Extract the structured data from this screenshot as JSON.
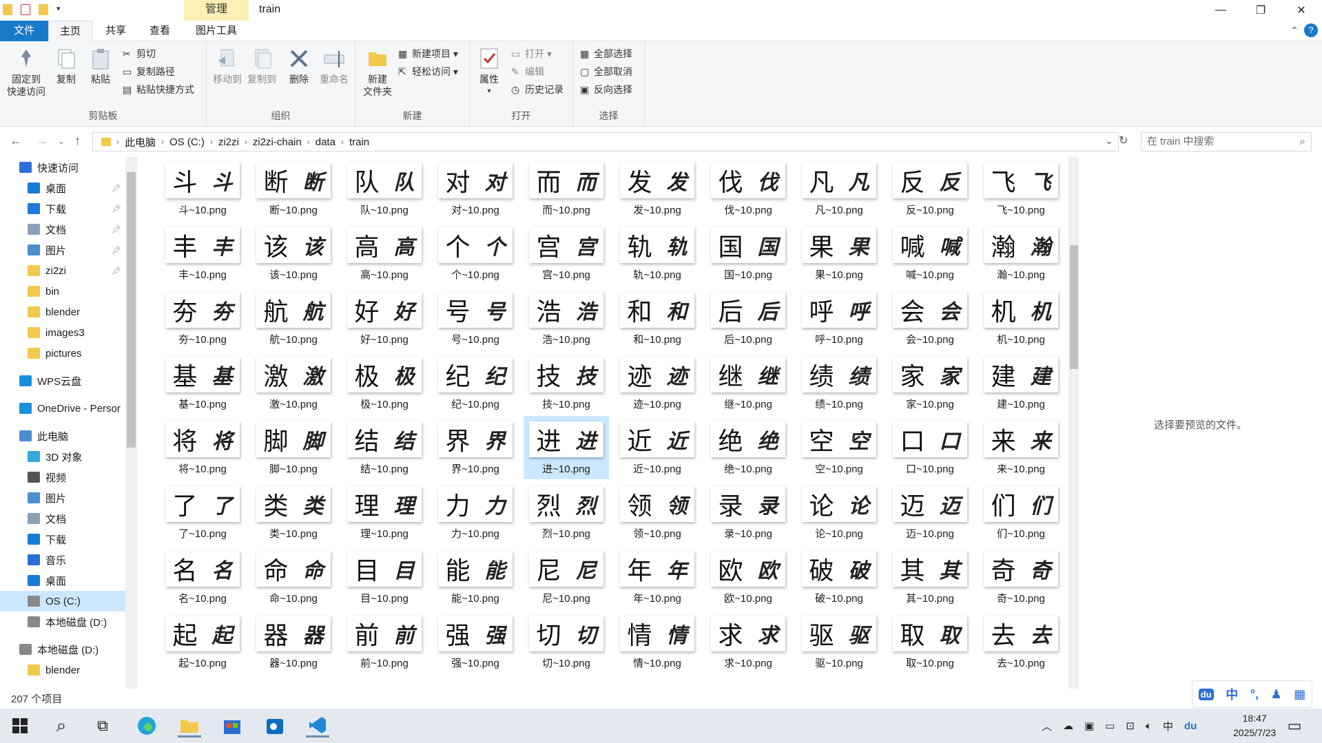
{
  "window": {
    "title": "train",
    "context_tab": "管理",
    "min": "—",
    "max": "❐",
    "close": "✕"
  },
  "tabs": {
    "file": "文件",
    "home": "主页",
    "share": "共享",
    "view": "查看",
    "picture_tools": "图片工具"
  },
  "ribbon": {
    "clipboard": {
      "pin": "固定到\n快速访问",
      "copy": "复制",
      "paste": "粘贴",
      "cut": "剪切",
      "copy_path": "复制路径",
      "paste_shortcut": "粘贴快捷方式",
      "label": "剪贴板"
    },
    "organize": {
      "move_to": "移动到",
      "copy_to": "复制到",
      "delete": "删除",
      "rename": "重命名",
      "label": "组织"
    },
    "new": {
      "new_folder": "新建\n文件夹",
      "new_item": "新建项目 ▾",
      "easy_access": "轻松访问 ▾",
      "label": "新建"
    },
    "open": {
      "properties": "属性",
      "open": "打开 ▾",
      "edit": "编辑",
      "history": "历史记录",
      "label": "打开"
    },
    "select": {
      "select_all": "全部选择",
      "select_none": "全部取消",
      "invert": "反向选择",
      "label": "选择"
    }
  },
  "address": {
    "crumbs": [
      "此电脑",
      "OS (C:)",
      "zi2zi",
      "zi2zi-chain",
      "data",
      "train"
    ],
    "search_placeholder": "在 train 中搜索"
  },
  "nav": {
    "items": [
      {
        "label": "快速访问",
        "level": 0,
        "icon": "star-icon",
        "pinned": false
      },
      {
        "label": "桌面",
        "level": 1,
        "icon": "desktop-icon",
        "pinned": true
      },
      {
        "label": "下载",
        "level": 1,
        "icon": "download-icon",
        "pinned": true
      },
      {
        "label": "文档",
        "level": 1,
        "icon": "document-icon",
        "pinned": true
      },
      {
        "label": "图片",
        "level": 1,
        "icon": "picture-icon",
        "pinned": true
      },
      {
        "label": "zi2zi",
        "level": 1,
        "icon": "folder-icon",
        "pinned": true
      },
      {
        "label": "bin",
        "level": 1,
        "icon": "folder-icon",
        "pinned": false
      },
      {
        "label": "blender",
        "level": 1,
        "icon": "folder-icon",
        "pinned": false
      },
      {
        "label": "images3",
        "level": 1,
        "icon": "folder-icon",
        "pinned": false
      },
      {
        "label": "pictures",
        "level": 1,
        "icon": "folder-icon",
        "pinned": false
      },
      {
        "label": "WPS云盘",
        "level": 0,
        "icon": "cloud-icon",
        "pinned": false
      },
      {
        "label": "OneDrive - Persor",
        "level": 0,
        "icon": "cloud-icon",
        "pinned": false
      },
      {
        "label": "此电脑",
        "level": 0,
        "icon": "computer-icon",
        "pinned": false
      },
      {
        "label": "3D 对象",
        "level": 1,
        "icon": "cube-icon",
        "pinned": false
      },
      {
        "label": "视频",
        "level": 1,
        "icon": "video-icon",
        "pinned": false
      },
      {
        "label": "图片",
        "level": 1,
        "icon": "picture-icon",
        "pinned": false
      },
      {
        "label": "文档",
        "level": 1,
        "icon": "document-icon",
        "pinned": false
      },
      {
        "label": "下载",
        "level": 1,
        "icon": "download-icon",
        "pinned": false
      },
      {
        "label": "音乐",
        "level": 1,
        "icon": "music-icon",
        "pinned": false
      },
      {
        "label": "桌面",
        "level": 1,
        "icon": "desktop-icon",
        "pinned": false
      },
      {
        "label": "OS (C:)",
        "level": 1,
        "icon": "drive-icon",
        "pinned": false,
        "selected": true
      },
      {
        "label": "本地磁盘 (D:)",
        "level": 1,
        "icon": "drive-icon",
        "pinned": false
      },
      {
        "label": "本地磁盘 (D:)",
        "level": 0,
        "icon": "drive-icon",
        "pinned": false
      },
      {
        "label": "blender",
        "level": 1,
        "icon": "folder-icon",
        "pinned": false
      }
    ]
  },
  "files": [
    [
      "斗",
      "断",
      "队",
      "对",
      "而",
      "发",
      "伐",
      "凡",
      "反",
      "飞"
    ],
    [
      "丰",
      "该",
      "高",
      "个",
      "宫",
      "轨",
      "国",
      "果",
      "喊",
      "瀚"
    ],
    [
      "夯",
      "航",
      "好",
      "号",
      "浩",
      "和",
      "后",
      "呼",
      "会",
      "机"
    ],
    [
      "基",
      "激",
      "极",
      "纪",
      "技",
      "迹",
      "继",
      "绩",
      "家",
      "建"
    ],
    [
      "将",
      "脚",
      "结",
      "界",
      "进",
      "近",
      "绝",
      "空",
      "口",
      "来"
    ],
    [
      "了",
      "类",
      "理",
      "力",
      "烈",
      "领",
      "录",
      "论",
      "迈",
      "们"
    ],
    [
      "名",
      "命",
      "目",
      "能",
      "尼",
      "年",
      "欧",
      "破",
      "其",
      "奇"
    ],
    [
      "起",
      "器",
      "前",
      "强",
      "切",
      "情",
      "求",
      "驱",
      "取",
      "去"
    ]
  ],
  "file_suffix": "~10.png",
  "selected_file": "进",
  "preview_msg": "选择要预览的文件。",
  "status": "207 个项目",
  "taskbar": {
    "time": "18:47",
    "date": "2025/7/23",
    "ime_lang": "中"
  }
}
